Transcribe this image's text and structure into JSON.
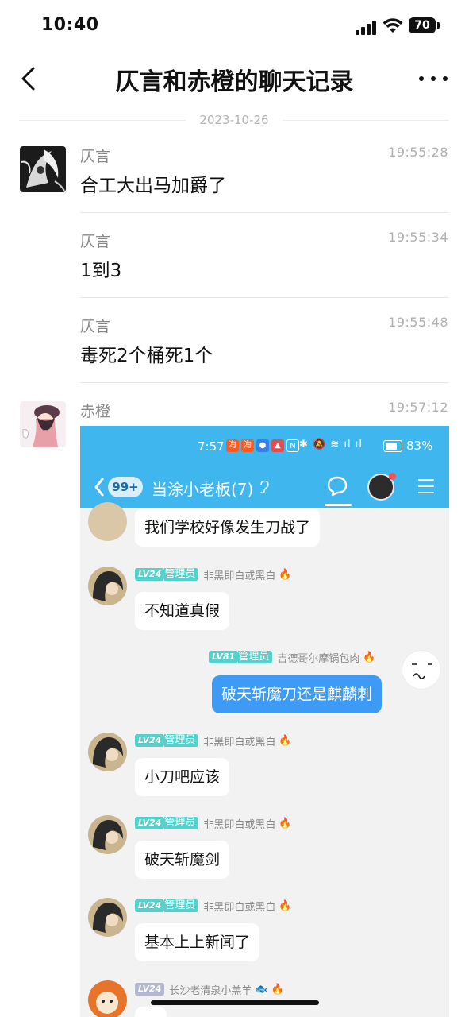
{
  "status_bar": {
    "time": "10:40",
    "battery": "70"
  },
  "nav": {
    "title": "仄言和赤橙的聊天记录"
  },
  "date": "2023-10-26",
  "messages": [
    {
      "sender": "仄言",
      "time": "19:55:28",
      "text": "合工大出马加爵了"
    },
    {
      "sender": "仄言",
      "time": "19:55:34",
      "text": "1到3"
    },
    {
      "sender": "仄言",
      "time": "19:55:48",
      "text": "毒死2个桶死1个"
    },
    {
      "sender": "赤橙",
      "time": "19:57:12",
      "text": ""
    }
  ],
  "embedded": {
    "status_time": "7:57",
    "battery_pct": "83%",
    "unread_badge": "99+",
    "group_title": "当涂小老板(7)",
    "chat": [
      {
        "side": "left",
        "text": "我们学校好像发生刀战了"
      },
      {
        "side": "left",
        "level": "LV24",
        "role": "管理员",
        "name": "非黑即白或黑白",
        "text": "不知道真假"
      },
      {
        "side": "right",
        "level": "LV81",
        "role": "管理员",
        "name": "吉德哥尔摩锅包肉",
        "text": "破天斩魔刀还是麒麟刺"
      },
      {
        "side": "left",
        "level": "LV24",
        "role": "管理员",
        "name": "非黑即白或黑白",
        "text": "小刀吧应该"
      },
      {
        "side": "left",
        "level": "LV24",
        "role": "管理员",
        "name": "非黑即白或黑白",
        "text": "破天斩魔剑"
      },
      {
        "side": "left",
        "level": "LV24",
        "role": "管理员",
        "name": "非黑即白或黑白",
        "text": "基本上上新闻了"
      },
      {
        "side": "left",
        "level": "LV24",
        "role": "",
        "name": "长沙老清泉小羔羊",
        "text": ""
      }
    ]
  }
}
